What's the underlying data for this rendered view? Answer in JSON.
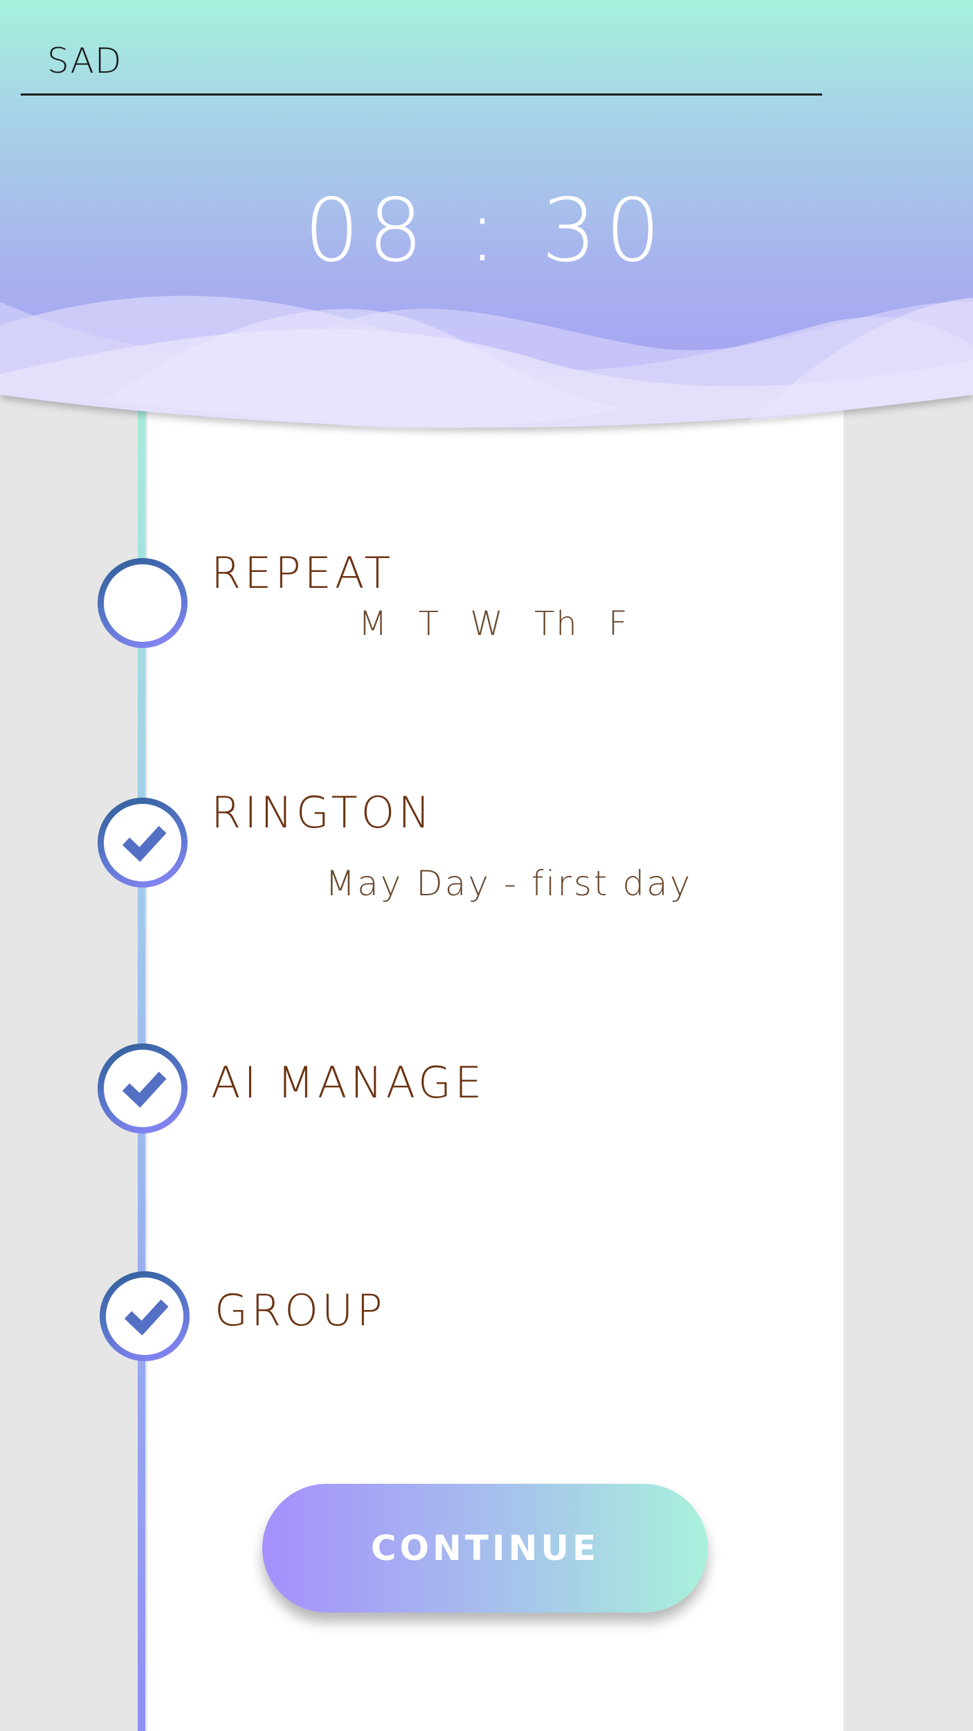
{
  "alarm": {
    "label_value": "SAD",
    "time": "08 : 30"
  },
  "steps": [
    {
      "title": "REPEAT",
      "subtitle": "M T W Th F",
      "checked": false
    },
    {
      "title": "RINGTON",
      "subtitle": "May Day - first day",
      "checked": true
    },
    {
      "title": "AI MANAGE",
      "checked": true
    },
    {
      "title": "GROUP",
      "checked": true
    }
  ],
  "continue_label": "CONTINUE",
  "colors": {
    "header_gradient_top": "#a6f1dc",
    "header_gradient_bottom": "#a59cf6",
    "title_text": "#6b3413",
    "button_gradient_start": "#a58ffc",
    "button_gradient_end": "#a9f1dc",
    "check_mark": "#5470c4"
  }
}
